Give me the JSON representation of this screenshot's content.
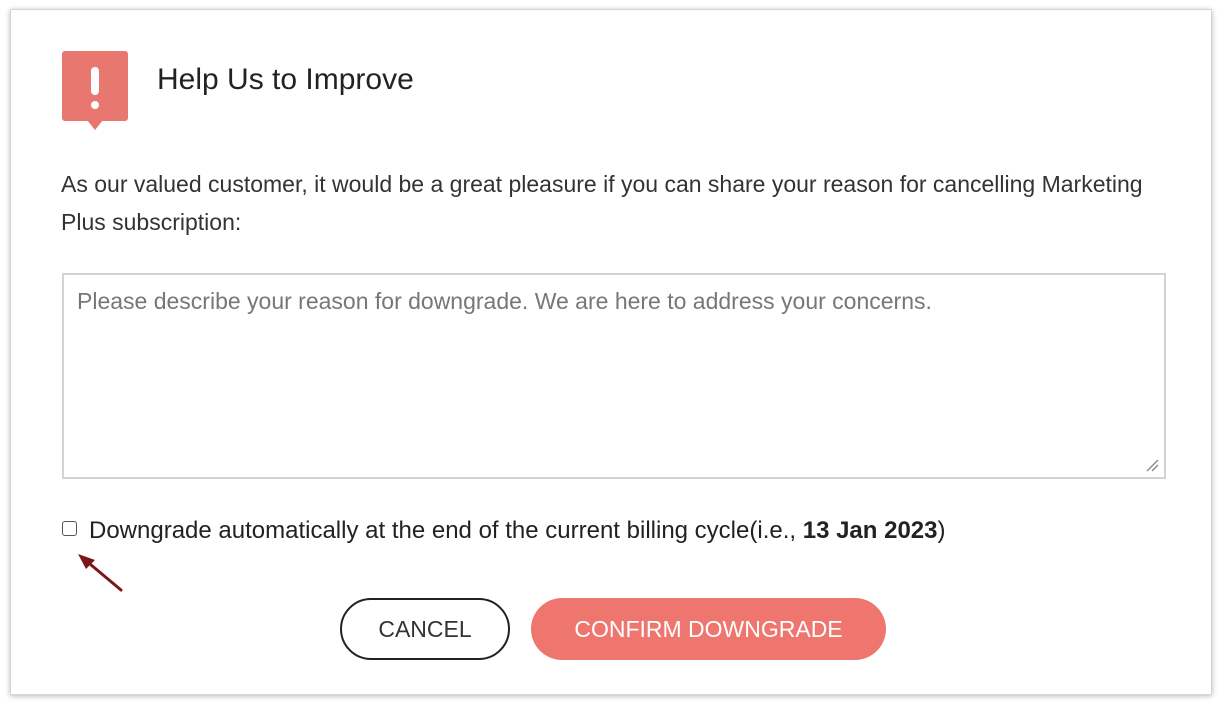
{
  "dialog": {
    "icon": "exclamation-alert-icon",
    "accent_color": "#EE766E",
    "title": "Help Us to Improve",
    "description": "As our valued customer, it would be a great pleasure if you can share your reason for cancelling Marketing Plus subscription:",
    "reason_input": {
      "value": "",
      "placeholder": "Please describe your reason for downgrade. We are here to address your concerns."
    },
    "auto_downgrade": {
      "checked": false,
      "label_prefix": "Downgrade automatically at the end of the current billing cycle(i.e., ",
      "date": "13 Jan 2023",
      "label_suffix": ")"
    },
    "annotation_icon": "pointer-arrow-icon",
    "buttons": {
      "cancel_label": "CANCEL",
      "confirm_label": "CONFIRM DOWNGRADE"
    }
  }
}
